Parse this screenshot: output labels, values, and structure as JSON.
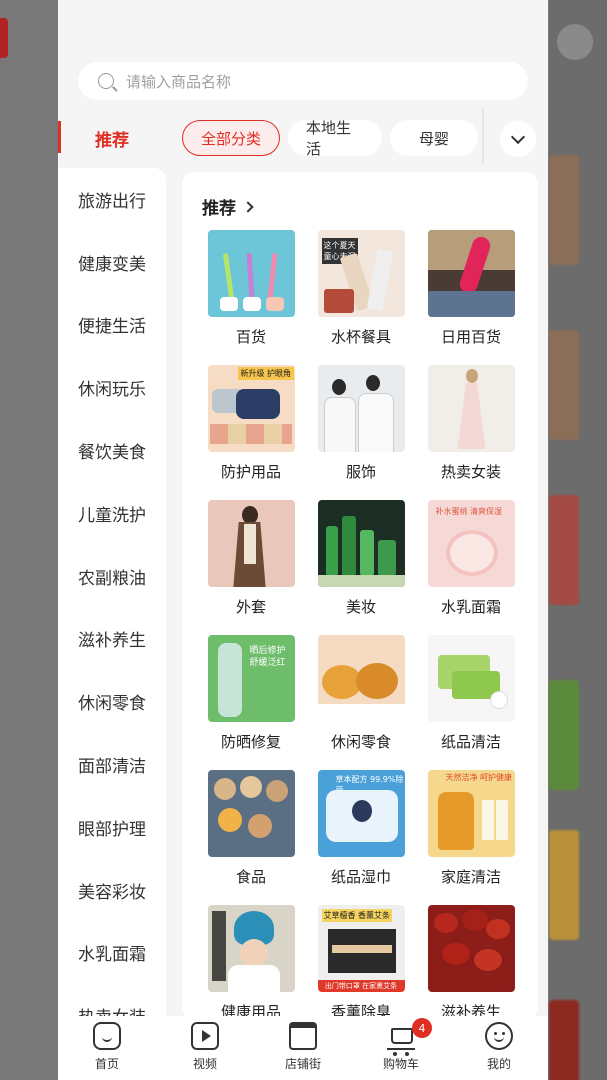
{
  "search": {
    "placeholder": "请输入商品名称"
  },
  "sidebar": {
    "active": "推荐",
    "items": [
      "旅游出行",
      "健康变美",
      "便捷生活",
      "休闲玩乐",
      "餐饮美食",
      "儿童洗护",
      "农副粮油",
      "滋补养生",
      "休闲零食",
      "面部清洁",
      "眼部护理",
      "美容彩妆",
      "水乳面霜",
      "热卖女装"
    ]
  },
  "tabs": [
    "全部分类",
    "本地生活",
    "母婴"
  ],
  "section": {
    "title": "推荐"
  },
  "grid": [
    {
      "label": "百货",
      "icon": "toothbrush-image"
    },
    {
      "label": "水杯餐具",
      "icon": "cup-image"
    },
    {
      "label": "日用百货",
      "icon": "daily-goods-image"
    },
    {
      "label": "防护用品",
      "icon": "mask-image"
    },
    {
      "label": "服饰",
      "icon": "clothing-image"
    },
    {
      "label": "热卖女装",
      "icon": "dress-image"
    },
    {
      "label": "外套",
      "icon": "coat-image"
    },
    {
      "label": "美妆",
      "icon": "cosmetics-image"
    },
    {
      "label": "水乳面霜",
      "icon": "cream-image"
    },
    {
      "label": "防晒修复",
      "icon": "sunscreen-image"
    },
    {
      "label": "休闲零食",
      "icon": "snack-image"
    },
    {
      "label": "纸品清洁",
      "icon": "paper-image"
    },
    {
      "label": "食品",
      "icon": "food-image"
    },
    {
      "label": "纸品湿巾",
      "icon": "wipes-image"
    },
    {
      "label": "家庭清洁",
      "icon": "cleaner-image"
    },
    {
      "label": "健康用品",
      "icon": "health-image"
    },
    {
      "label": "香薰除臭",
      "icon": "aroma-image"
    },
    {
      "label": "滋补养生",
      "icon": "dates-image"
    }
  ],
  "thumb_text": {
    "cup": [
      "这个夏天",
      "童心未泯"
    ],
    "mask": "新升级 护眼角",
    "sun": [
      "晒后修护",
      "舒缓泛红"
    ],
    "cream": "补水蜜桃 清爽保湿",
    "wipes": "草本配方 99.9%除菌",
    "clean": "天然洁净 呵护健康",
    "aroma": [
      "艾草檀香 香薰艾条",
      "出门带口罩 在家熏艾条"
    ]
  },
  "bottom_nav": [
    {
      "label": "首页",
      "icon": "home-icon"
    },
    {
      "label": "视频",
      "icon": "video-icon"
    },
    {
      "label": "店铺街",
      "icon": "store-icon"
    },
    {
      "label": "购物车",
      "icon": "cart-icon",
      "badge": "4"
    },
    {
      "label": "我的",
      "icon": "profile-icon"
    }
  ],
  "colors": {
    "accent": "#e02e24",
    "sheet_bg": "#f5f5f5"
  }
}
